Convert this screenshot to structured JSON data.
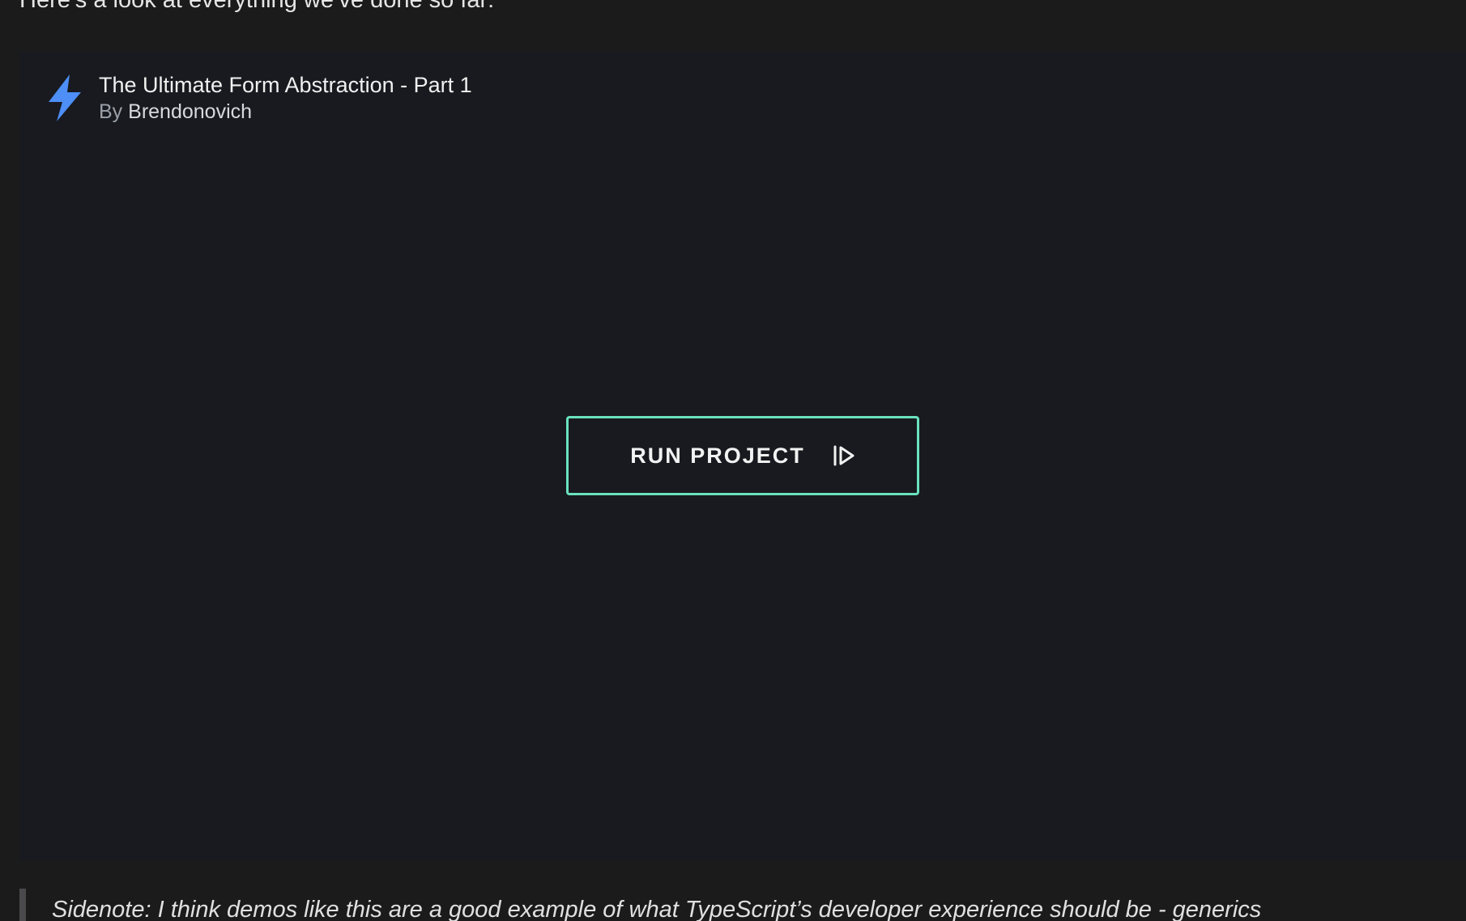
{
  "intro": {
    "text": "Here’s a look at everything we’ve done so far:"
  },
  "embed": {
    "icon": "stackblitz-bolt-icon",
    "icon_color": "#4d8ef7",
    "title": "The Ultimate Form Abstraction - Part 1",
    "byline_prefix": "By",
    "author": "Brendonovich",
    "run_button": {
      "label": "RUN PROJECT",
      "icon": "run-icon",
      "border_color": "#69e2bd"
    }
  },
  "quote": {
    "text": "Sidenote: I think demos like this are a good example of what TypeScript’s developer experience should be - generics"
  }
}
